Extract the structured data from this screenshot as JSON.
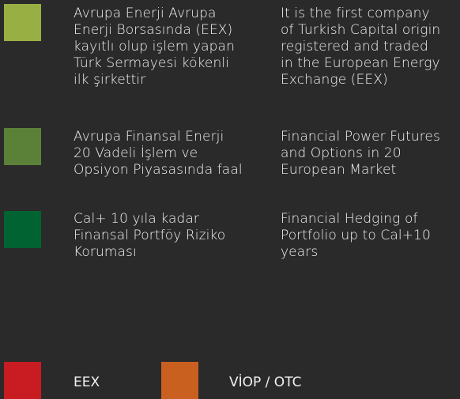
{
  "colors": {
    "background": "#2a2a2a",
    "row1": "#98b043",
    "row2": "#5b8138",
    "row3": "#006331",
    "eex": "#c81c22",
    "viop": "#c9601f"
  },
  "rows": [
    {
      "tr": "Avrupa Enerji Avrupa\nEnerji Borsasında (EEX)\nkayıtlı olup işlem yapan\nTürk Sermayesi kökenli\nilk şirkettir",
      "en": "It is the first company\nof Turkish Capital origin\nregistered and traded\nin the European Energy\nExchange (EEX)"
    },
    {
      "tr": "Avrupa Finansal Enerji\n20 Vadeli İşlem ve\nOpsiyon Piyasasında faal",
      "en": "Financial Power Futures\nand Options in 20\nEuropean Market"
    },
    {
      "tr": "Cal+ 10 yıla kadar\nFinansal Portföy Riziko\nKoruması",
      "en": "Financial Hedging of\nPortfolio up to Cal+10\nyears"
    }
  ],
  "legend": [
    {
      "label": "EEX"
    },
    {
      "label": "VİOP / OTC"
    }
  ]
}
